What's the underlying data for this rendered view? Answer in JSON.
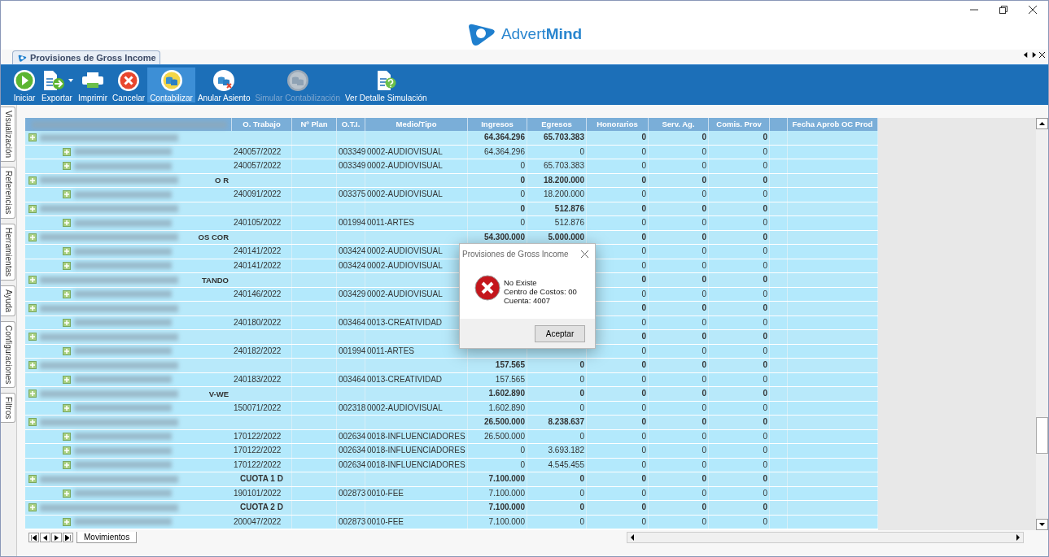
{
  "header": {
    "logo": "Advert**Mind**"
  },
  "document_tab": {
    "label": "Provisiones de Gross Income",
    "selected": true
  },
  "toolbar": {
    "buttons": [
      {
        "label": "Iniciar",
        "kind": "play",
        "selected": false,
        "disabled": false
      },
      {
        "label": "Exportar",
        "kind": "export",
        "selected": false,
        "disabled": false,
        "dropdown": true
      },
      {
        "label": "Imprimir",
        "kind": "print",
        "selected": false,
        "disabled": false
      },
      {
        "label": "Cancelar",
        "kind": "cancel",
        "selected": false,
        "disabled": false
      },
      {
        "label": "Contabilizar",
        "kind": "coins",
        "selected": true,
        "disabled": false
      },
      {
        "label": "Anular Asiento",
        "kind": "coins-x",
        "selected": false,
        "disabled": false
      },
      {
        "label": "Simular Contabilización",
        "kind": "coins",
        "selected": false,
        "disabled": true
      },
      {
        "label": "Ver Detalle Simulación",
        "kind": "help-doc",
        "selected": false,
        "disabled": false
      }
    ]
  },
  "side_tabs": [
    "Visualización",
    "Referencias",
    "Herramientas",
    "Ayuda",
    "Configuraciones",
    "Filtros"
  ],
  "table": {
    "columns": [
      "O. Trabajo",
      "Nº Plan",
      "O.T.I.",
      "Medio/Tipo",
      "Ingresos",
      "Egresos",
      "Honorarios",
      "Serv. Ag.",
      "Comis. Prov",
      "Fecha Aprob OC Prod"
    ],
    "rows": [
      {
        "kind": "group",
        "ingresos": "64.364.296",
        "egresos": "65.703.383",
        "honorarios": "0",
        "serv_ag": "0",
        "comis_prov": "0"
      },
      {
        "kind": "detail",
        "o_trabajo": "240057/2022",
        "oti": "003349",
        "medio": "0002-AUDIOVISUAL",
        "ingresos": "64.364.296",
        "egresos": "0",
        "honorarios": "0",
        "serv_ag": "0",
        "comis_prov": "0"
      },
      {
        "kind": "detail",
        "o_trabajo": "240057/2022",
        "oti": "003349",
        "medio": "0002-AUDIOVISUAL",
        "ingresos": "0",
        "egresos": "65.703.383",
        "honorarios": "0",
        "serv_ag": "0",
        "comis_prov": "0"
      },
      {
        "kind": "group",
        "name_tail": "O R",
        "ingresos": "0",
        "egresos": "18.200.000",
        "honorarios": "0",
        "serv_ag": "0",
        "comis_prov": "0"
      },
      {
        "kind": "detail",
        "o_trabajo": "240091/2022",
        "oti": "003375",
        "medio": "0002-AUDIOVISUAL",
        "ingresos": "0",
        "egresos": "18.200.000",
        "honorarios": "0",
        "serv_ag": "0",
        "comis_prov": "0"
      },
      {
        "kind": "group",
        "ingresos": "0",
        "egresos": "512.876",
        "honorarios": "0",
        "serv_ag": "0",
        "comis_prov": "0"
      },
      {
        "kind": "detail",
        "o_trabajo": "240105/2022",
        "oti": "001994",
        "medio": "0011-ARTES",
        "ingresos": "0",
        "egresos": "512.876",
        "honorarios": "0",
        "serv_ag": "0",
        "comis_prov": "0"
      },
      {
        "kind": "group",
        "name_tail": "OS COR",
        "ingresos": "54.300.000",
        "egresos": "5.000.000",
        "honorarios": "0",
        "serv_ag": "0",
        "comis_prov": "0"
      },
      {
        "kind": "detail",
        "o_trabajo": "240141/2022",
        "oti": "003424",
        "medio": "0002-AUDIOVISUAL",
        "honorarios": "0",
        "serv_ag": "0",
        "comis_prov": "0"
      },
      {
        "kind": "detail",
        "o_trabajo": "240141/2022",
        "oti": "003424",
        "medio": "0002-AUDIOVISUAL",
        "honorarios": "0",
        "serv_ag": "0",
        "comis_prov": "0"
      },
      {
        "kind": "group",
        "name_tail": "TANDO",
        "honorarios": "0",
        "serv_ag": "0",
        "comis_prov": "0"
      },
      {
        "kind": "detail",
        "o_trabajo": "240146/2022",
        "oti": "003429",
        "medio": "0002-AUDIOVISUAL",
        "honorarios": "0",
        "serv_ag": "0",
        "comis_prov": "0"
      },
      {
        "kind": "group",
        "honorarios": "0",
        "serv_ag": "0",
        "comis_prov": "0"
      },
      {
        "kind": "detail",
        "o_trabajo": "240180/2022",
        "oti": "003464",
        "medio": "0013-CREATIVIDAD",
        "honorarios": "0",
        "serv_ag": "0",
        "comis_prov": "0"
      },
      {
        "kind": "group",
        "honorarios": "0",
        "serv_ag": "0",
        "comis_prov": "0"
      },
      {
        "kind": "detail",
        "o_trabajo": "240182/2022",
        "oti": "001994",
        "medio": "0011-ARTES",
        "honorarios": "0",
        "serv_ag": "0",
        "comis_prov": "0"
      },
      {
        "kind": "group",
        "ingresos": "157.565",
        "egresos": "0",
        "honorarios": "0",
        "serv_ag": "0",
        "comis_prov": "0"
      },
      {
        "kind": "detail",
        "o_trabajo": "240183/2022",
        "oti": "003464",
        "medio": "0013-CREATIVIDAD",
        "ingresos": "157.565",
        "egresos": "0",
        "honorarios": "0",
        "serv_ag": "0",
        "comis_prov": "0"
      },
      {
        "kind": "group",
        "name_tail": "V-WE",
        "ingresos": "1.602.890",
        "egresos": "0",
        "honorarios": "0",
        "serv_ag": "0",
        "comis_prov": "0"
      },
      {
        "kind": "detail",
        "o_trabajo": "150071/2022",
        "oti": "002318",
        "medio": "0002-AUDIOVISUAL",
        "ingresos": "1.602.890",
        "egresos": "0",
        "honorarios": "0",
        "serv_ag": "0",
        "comis_prov": "0"
      },
      {
        "kind": "group",
        "ingresos": "26.500.000",
        "egresos": "8.238.637",
        "honorarios": "0",
        "serv_ag": "0",
        "comis_prov": "0"
      },
      {
        "kind": "detail",
        "o_trabajo": "170122/2022",
        "oti": "002634",
        "medio": "0018-INFLUENCIADORES",
        "ingresos": "26.500.000",
        "egresos": "0",
        "honorarios": "0",
        "serv_ag": "0",
        "comis_prov": "0"
      },
      {
        "kind": "detail",
        "o_trabajo": "170122/2022",
        "oti": "002634",
        "medio": "0018-INFLUENCIADORES",
        "ingresos": "0",
        "egresos": "3.693.182",
        "honorarios": "0",
        "serv_ag": "0",
        "comis_prov": "0"
      },
      {
        "kind": "detail",
        "o_trabajo": "170122/2022",
        "oti": "002634",
        "medio": "0018-INFLUENCIADORES",
        "ingresos": "0",
        "egresos": "4.545.455",
        "honorarios": "0",
        "serv_ag": "0",
        "comis_prov": "0"
      },
      {
        "kind": "group",
        "o_trabajo": "CUOTA 1 D",
        "ingresos": "7.100.000",
        "egresos": "0",
        "honorarios": "0",
        "serv_ag": "0",
        "comis_prov": "0"
      },
      {
        "kind": "detail",
        "o_trabajo": "190101/2022",
        "oti": "002873",
        "medio": "0010-FEE",
        "ingresos": "7.100.000",
        "egresos": "0",
        "honorarios": "0",
        "serv_ag": "0",
        "comis_prov": "0"
      },
      {
        "kind": "group",
        "o_trabajo": "CUOTA 2 D",
        "ingresos": "7.100.000",
        "egresos": "0",
        "honorarios": "0",
        "serv_ag": "0",
        "comis_prov": "0"
      },
      {
        "kind": "detail",
        "o_trabajo": "200047/2022",
        "oti": "002873",
        "medio": "0010-FEE",
        "ingresos": "7.100.000",
        "egresos": "0",
        "honorarios": "0",
        "serv_ag": "0",
        "comis_prov": "0"
      }
    ]
  },
  "sheet_tabs": [
    {
      "label": "Movimientos",
      "selected": true
    }
  ],
  "dialog": {
    "title": "Provisiones de Gross Income",
    "lines": [
      "No Existe",
      "Centro de Costos: 00",
      "Cuenta: 4007"
    ],
    "button": "Aceptar"
  }
}
